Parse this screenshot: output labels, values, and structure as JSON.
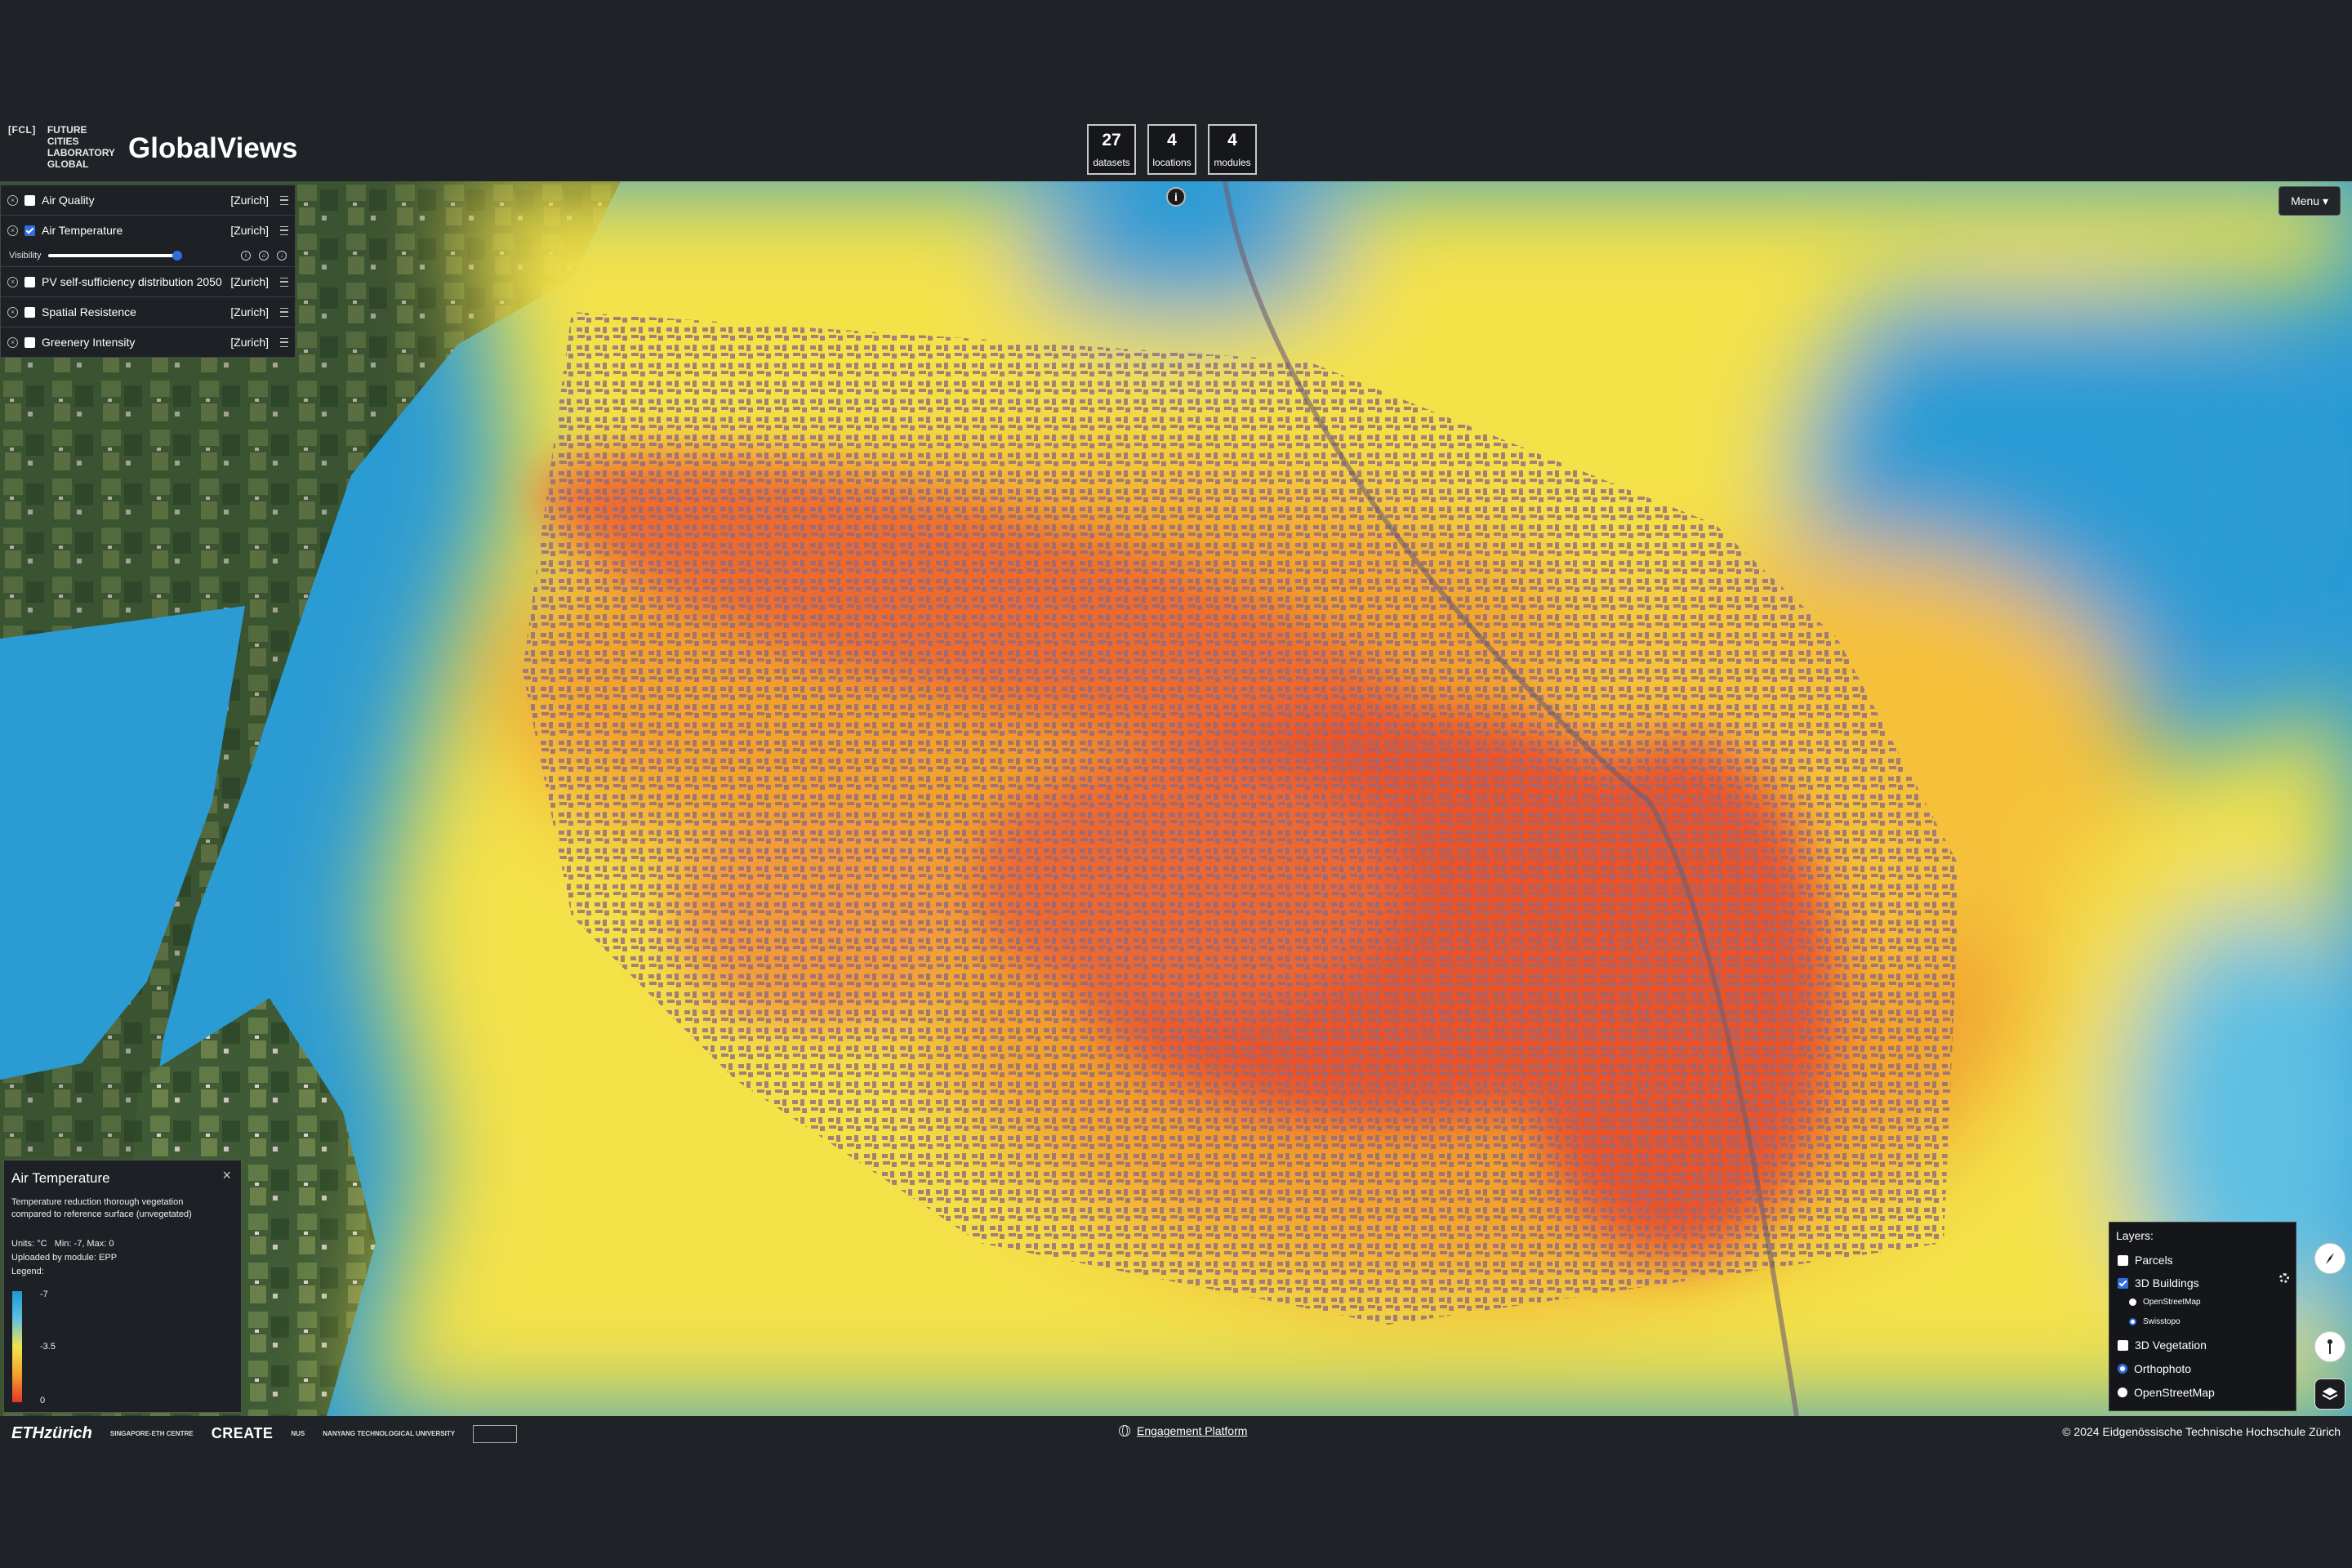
{
  "brand": {
    "tag": "[FCL]",
    "lines": [
      "FUTURE",
      "CITIES",
      "LABORATORY",
      "GLOBAL"
    ],
    "app_title": "GlobalViews"
  },
  "stats": [
    {
      "value": "27",
      "label": "datasets"
    },
    {
      "value": "4",
      "label": "locations"
    },
    {
      "value": "4",
      "label": "modules"
    }
  ],
  "info_glyph": "i",
  "menu_label": "Menu ▾",
  "layers": [
    {
      "name": "Air Quality",
      "location": "[Zurich]",
      "checked": false
    },
    {
      "name": "Air Temperature",
      "location": "[Zurich]",
      "checked": true
    },
    {
      "name": "PV self-sufficiency distribution 2050",
      "location": "[Zurich]",
      "checked": false
    },
    {
      "name": "Spatial Resistence",
      "location": "[Zurich]",
      "checked": false
    },
    {
      "name": "Greenery Intensity",
      "location": "[Zurich]",
      "checked": false
    }
  ],
  "visibility_label": "Visibility",
  "visibility_value": 1.0,
  "legend": {
    "title": "Air Temperature",
    "close": "×",
    "description": "Temperature reduction thorough vegetation compared to reference surface (unvegetated)",
    "units": "Units: °C",
    "minmax": "Min: -7, Max: 0",
    "uploaded": "Uploaded by module: EPP",
    "legend_label": "Legend:",
    "ticks": [
      "-7",
      "-3.5",
      "0"
    ],
    "colors": [
      "#1a9ad6",
      "#5fc0e3",
      "#f2e64a",
      "#f2a22f",
      "#e7342a"
    ]
  },
  "basemap": {
    "title": "Layers:",
    "parcels": "Parcels",
    "buildings": "3D Buildings",
    "buildings_sources": [
      "OpenStreetMap",
      "Swisstopo"
    ],
    "buildings_source_selected": "Swisstopo",
    "vegetation": "3D Vegetation",
    "base_options": [
      "Orthophoto",
      "OpenStreetMap"
    ],
    "base_selected": "Orthophoto"
  },
  "footer": {
    "eth": "ETHzürich",
    "sec": "SINGAPORE-ETH CENTRE",
    "create": "CREATE",
    "nus": "NUS",
    "ntu": "NANYANG TECHNOLOGICAL UNIVERSITY",
    "engagement": "Engagement Platform",
    "copyright": "© 2024 Eidgenössische Technische Hochschule Zürich"
  },
  "icons": {
    "close": "x-circle-icon",
    "hamburger": "hamburger-icon",
    "info": "info-icon",
    "compass": "compass-icon",
    "tilt": "tilt-icon",
    "layers": "layers-icon",
    "globe": "globe-icon",
    "gear": "gear-icon"
  }
}
